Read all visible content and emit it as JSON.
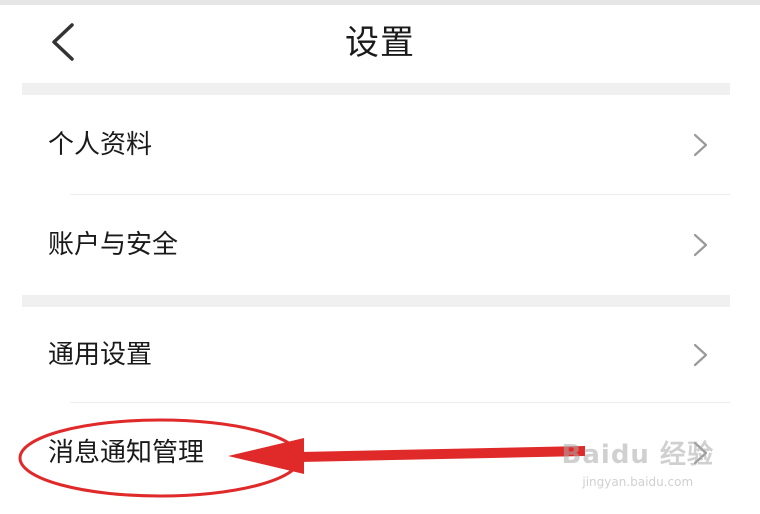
{
  "header": {
    "title": "设置"
  },
  "settings": {
    "rows": [
      {
        "label": "个人资料"
      },
      {
        "label": "账户与安全"
      },
      {
        "label": "通用设置"
      },
      {
        "label": "消息通知管理"
      }
    ]
  },
  "icons": {
    "back": "chevron-left-icon",
    "row_arrow": "chevron-right-icon"
  },
  "colors": {
    "annotation": "#e02a2a",
    "chevron": "#9a9a9a",
    "section_gap": "#f0f0f0"
  },
  "watermark": {
    "main": "Baidu 经验",
    "sub": "jingyan.baidu.com"
  }
}
